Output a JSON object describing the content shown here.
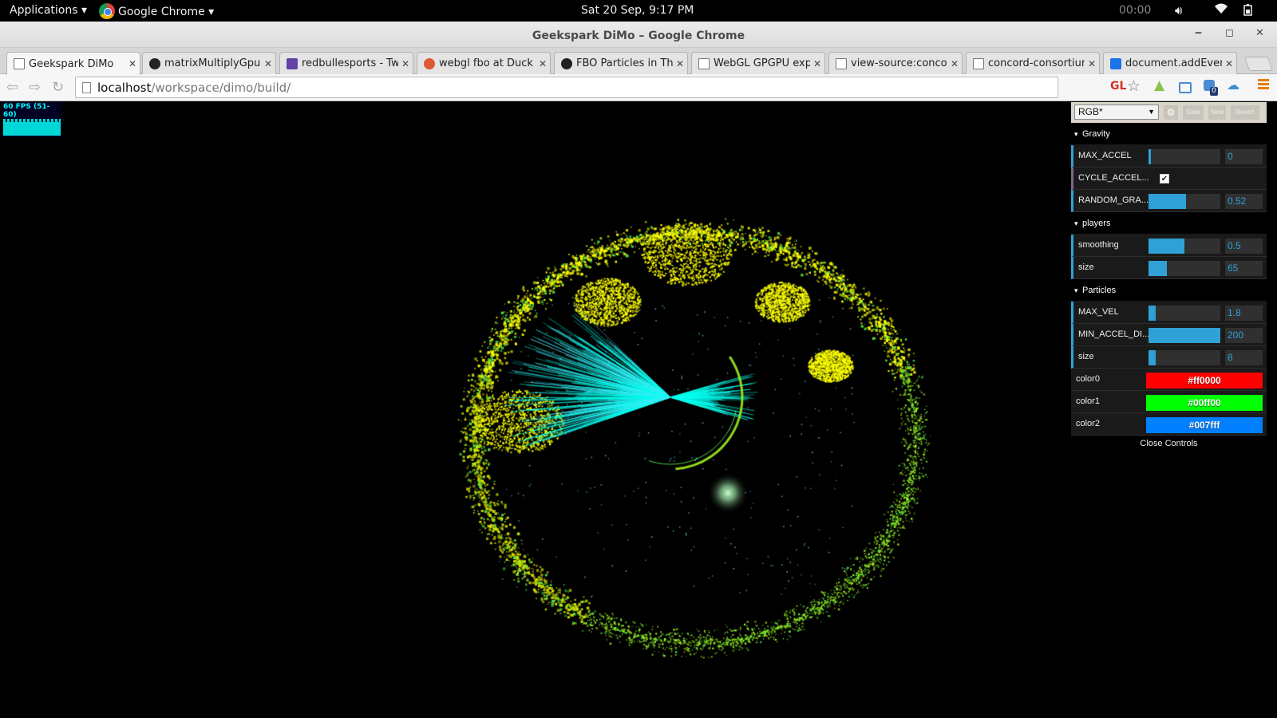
{
  "topbar": {
    "applications": "Applications ▾",
    "active_app": "Google Chrome ▾",
    "clock": "Sat 20 Sep,  9:17 PM",
    "timer": "00:00",
    "sound_icon": "speaker-icon",
    "wifi_icon": "wifi-icon",
    "battery_icon": "battery-icon"
  },
  "window": {
    "title": "Geekspark DiMo – Google Chrome",
    "minimize": "‒",
    "maximize": "◻",
    "close": "✕"
  },
  "tabs": [
    {
      "label": "Geekspark DiMo",
      "icon": "doc",
      "active": true
    },
    {
      "label": "matrixMultiplyGpu",
      "icon": "github"
    },
    {
      "label": "redbullesports - Tw",
      "icon": "twitch"
    },
    {
      "label": "webgl fbo at Duck",
      "icon": "duckduckgo"
    },
    {
      "label": "FBO Particles in Th",
      "icon": "github"
    },
    {
      "label": "WebGL GPGPU exp",
      "icon": "doc"
    },
    {
      "label": "view-source:conco",
      "icon": "doc"
    },
    {
      "label": "concord-consortium",
      "icon": "doc"
    },
    {
      "label": "document.addEven",
      "icon": "blue"
    }
  ],
  "toolbar": {
    "url_host": "localhost",
    "url_path": "/workspace/dimo/build/",
    "gl_indicator": "GL",
    "ext_badge_count": "0"
  },
  "stats": {
    "fps_text": "60 FPS (51-60)"
  },
  "gui": {
    "preset": "RGB*",
    "gear": "⚙",
    "save": "Save",
    "new": "New",
    "revert": "Revert",
    "folders": {
      "gravity": "Gravity",
      "players": "players",
      "particles": "Particles"
    },
    "gravity": {
      "max_accel": {
        "label": "MAX_ACCEL",
        "value": "0",
        "fraction": 0.0
      },
      "cycle_accel": {
        "label": "CYCLE_ACCEL...",
        "checked": "✔"
      },
      "random_gra": {
        "label": "RANDOM_GRA...",
        "value": "0.52",
        "fraction": 0.52
      }
    },
    "players": {
      "smoothing": {
        "label": "smoothing",
        "value": "0.5",
        "fraction": 0.5
      },
      "size": {
        "label": "size",
        "value": "65",
        "fraction": 0.25
      }
    },
    "particles": {
      "max_vel": {
        "label": "MAX_VEL",
        "value": "1.8",
        "fraction": 0.1
      },
      "min_accel": {
        "label": "MIN_ACCEL_DI...",
        "value": "200",
        "fraction": 1.0
      },
      "size": {
        "label": "size",
        "value": "8",
        "fraction": 0.1
      },
      "color0": {
        "label": "color0",
        "value": "#ff0000"
      },
      "color1": {
        "label": "color1",
        "value": "#00ff00"
      },
      "color2": {
        "label": "color2",
        "value": "#007fff"
      }
    },
    "close": "Close Controls"
  },
  "scene": {
    "colors": [
      "#ffff00",
      "#d8e600",
      "#9cef20",
      "#4fe84a",
      "#00ffee",
      "#66ddff"
    ],
    "glow_color": "#c8ffd0"
  }
}
